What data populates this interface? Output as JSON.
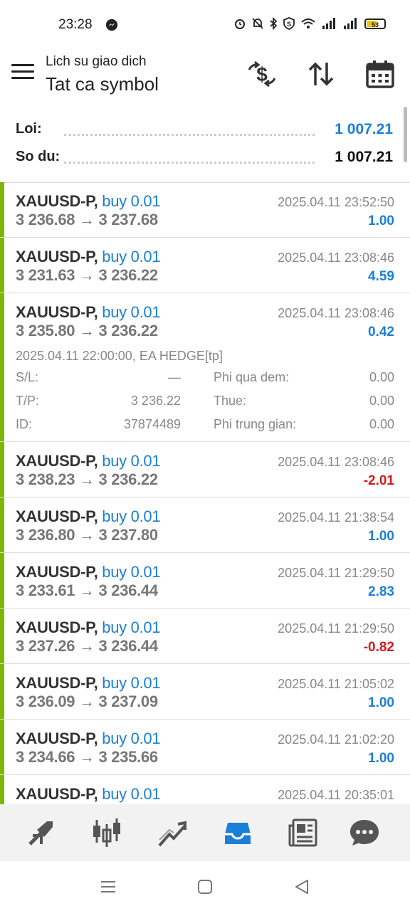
{
  "status": {
    "time": "23:28",
    "battery": "53"
  },
  "header": {
    "subtitle": "Lich su giao dich",
    "title": "Tat ca symbol"
  },
  "summary": {
    "profit_label": "Loi:",
    "profit_value": "1 007.21",
    "profit_color": "#1a7fd8",
    "balance_label": "So du:",
    "balance_value": "1 007.21"
  },
  "trades": [
    {
      "symbol": "XAUUSD-P,",
      "side": "buy 0.01",
      "prices": "3 236.68 → 3 237.68",
      "time": "2025.04.11 23:52:50",
      "profit": "1.00",
      "sign": "pos"
    },
    {
      "symbol": "XAUUSD-P,",
      "side": "buy 0.01",
      "prices": "3 231.63 → 3 236.22",
      "time": "2025.04.11 23:08:46",
      "profit": "4.59",
      "sign": "pos"
    },
    {
      "symbol": "XAUUSD-P,",
      "side": "buy 0.01",
      "prices": "3 235.80 → 3 236.22",
      "time": "2025.04.11 23:08:46",
      "profit": "0.42",
      "sign": "pos",
      "detail": {
        "open": "2025.04.11 22:00:00, EA HEDGE[tp]",
        "sl_label": "S/L:",
        "sl_value": "—",
        "tp_label": "T/P:",
        "tp_value": "3 236.22",
        "id_label": "ID:",
        "id_value": "37874489",
        "swap_label": "Phi qua dem:",
        "swap_value": "0.00",
        "tax_label": "Thue:",
        "tax_value": "0.00",
        "comm_label": "Phi trung gian:",
        "comm_value": "0.00"
      }
    },
    {
      "symbol": "XAUUSD-P,",
      "side": "buy 0.01",
      "prices": "3 238.23 → 3 236.22",
      "time": "2025.04.11 23:08:46",
      "profit": "-2.01",
      "sign": "neg"
    },
    {
      "symbol": "XAUUSD-P,",
      "side": "buy 0.01",
      "prices": "3 236.80 → 3 237.80",
      "time": "2025.04.11 21:38:54",
      "profit": "1.00",
      "sign": "pos"
    },
    {
      "symbol": "XAUUSD-P,",
      "side": "buy 0.01",
      "prices": "3 233.61 → 3 236.44",
      "time": "2025.04.11 21:29:50",
      "profit": "2.83",
      "sign": "pos"
    },
    {
      "symbol": "XAUUSD-P,",
      "side": "buy 0.01",
      "prices": "3 237.26 → 3 236.44",
      "time": "2025.04.11 21:29:50",
      "profit": "-0.82",
      "sign": "neg"
    },
    {
      "symbol": "XAUUSD-P,",
      "side": "buy 0.01",
      "prices": "3 236.09 → 3 237.09",
      "time": "2025.04.11 21:05:02",
      "profit": "1.00",
      "sign": "pos"
    },
    {
      "symbol": "XAUUSD-P,",
      "side": "buy 0.01",
      "prices": "3 234.66 → 3 235.66",
      "time": "2025.04.11 21:02:20",
      "profit": "1.00",
      "sign": "pos"
    },
    {
      "symbol": "XAUUSD-P,",
      "side": "buy 0.01",
      "prices": "",
      "time": "2025.04.11 20:35:01",
      "profit": "",
      "sign": "pos"
    }
  ],
  "nav": {
    "items": [
      "trade-icon",
      "chart-icon",
      "trend-icon",
      "history-icon",
      "news-icon",
      "chat-icon"
    ],
    "active": "history-icon",
    "active_color": "#1a7fd8",
    "buy_bar_color": "#7cb800"
  }
}
